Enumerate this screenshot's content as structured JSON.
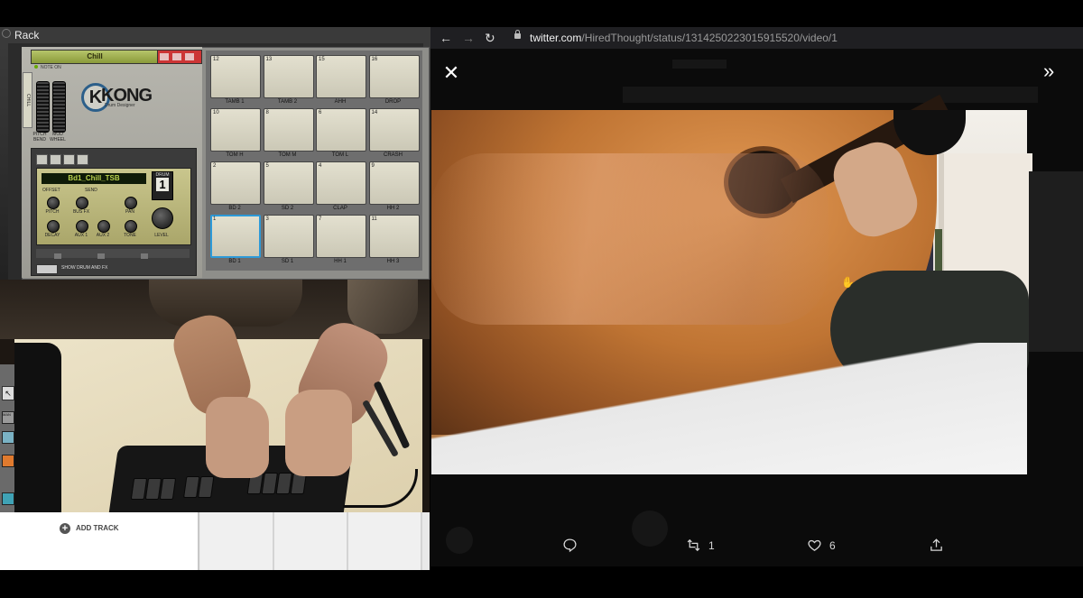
{
  "rack": {
    "title": "Rack",
    "patch_name": "Chill",
    "note_on": "NOTE ON",
    "strip_label": "CHILL",
    "pitch_bend": "PITCH BEND",
    "mod_wheel": "MOD WHEEL",
    "logo": "KONG",
    "logo_k": "K",
    "logo_sub": "Drum Designer",
    "drum_name": "Bd1_Chill_TSB",
    "drum_label": "DRUM",
    "drum_number": "1",
    "knob_section_offset": "OFFSET",
    "knob_section_send": "SEND",
    "knobs": [
      "PITCH",
      "BUS FX",
      "PAN",
      "DECAY",
      "AUX 1",
      "AUX 2",
      "TONE",
      "LEVEL"
    ],
    "show_drum_fx": "SHOW DRUM AND FX",
    "pads": [
      {
        "num": "12",
        "label": "TAMB 1"
      },
      {
        "num": "13",
        "label": "TAMB 2"
      },
      {
        "num": "15",
        "label": "AHH"
      },
      {
        "num": "16",
        "label": "DROP"
      },
      {
        "num": "10",
        "label": "TOM H"
      },
      {
        "num": "8",
        "label": "TOM M"
      },
      {
        "num": "6",
        "label": "TOM L"
      },
      {
        "num": "14",
        "label": "CRASH"
      },
      {
        "num": "2",
        "label": "BD 2"
      },
      {
        "num": "5",
        "label": "SD 2"
      },
      {
        "num": "4",
        "label": "CLAP"
      },
      {
        "num": "9",
        "label": "HH 2"
      },
      {
        "num": "1",
        "label": "BD 1"
      },
      {
        "num": "3",
        "label": "SD 1"
      },
      {
        "num": "7",
        "label": "HH 1"
      },
      {
        "num": "11",
        "label": "HH 3"
      }
    ],
    "selected_pad": "1"
  },
  "sequencer": {
    "add_track": "ADD TRACK",
    "side_label": "MAN"
  },
  "browser": {
    "url_host": "twitter.com",
    "url_path": "/HiredThought/status/1314250223015915520/video/1",
    "nav": {
      "back": "←",
      "forward": "→",
      "reload": "↻"
    }
  },
  "video": {
    "close": "✕",
    "expand": "»",
    "next": "→"
  },
  "tweet_actions": {
    "reply_count": "",
    "retweet_count": "1",
    "like_count": "6"
  },
  "colors": {
    "accent_blue": "#2d9ad8",
    "patch_red": "#cc3535",
    "lcd_green": "#b9d24f"
  }
}
